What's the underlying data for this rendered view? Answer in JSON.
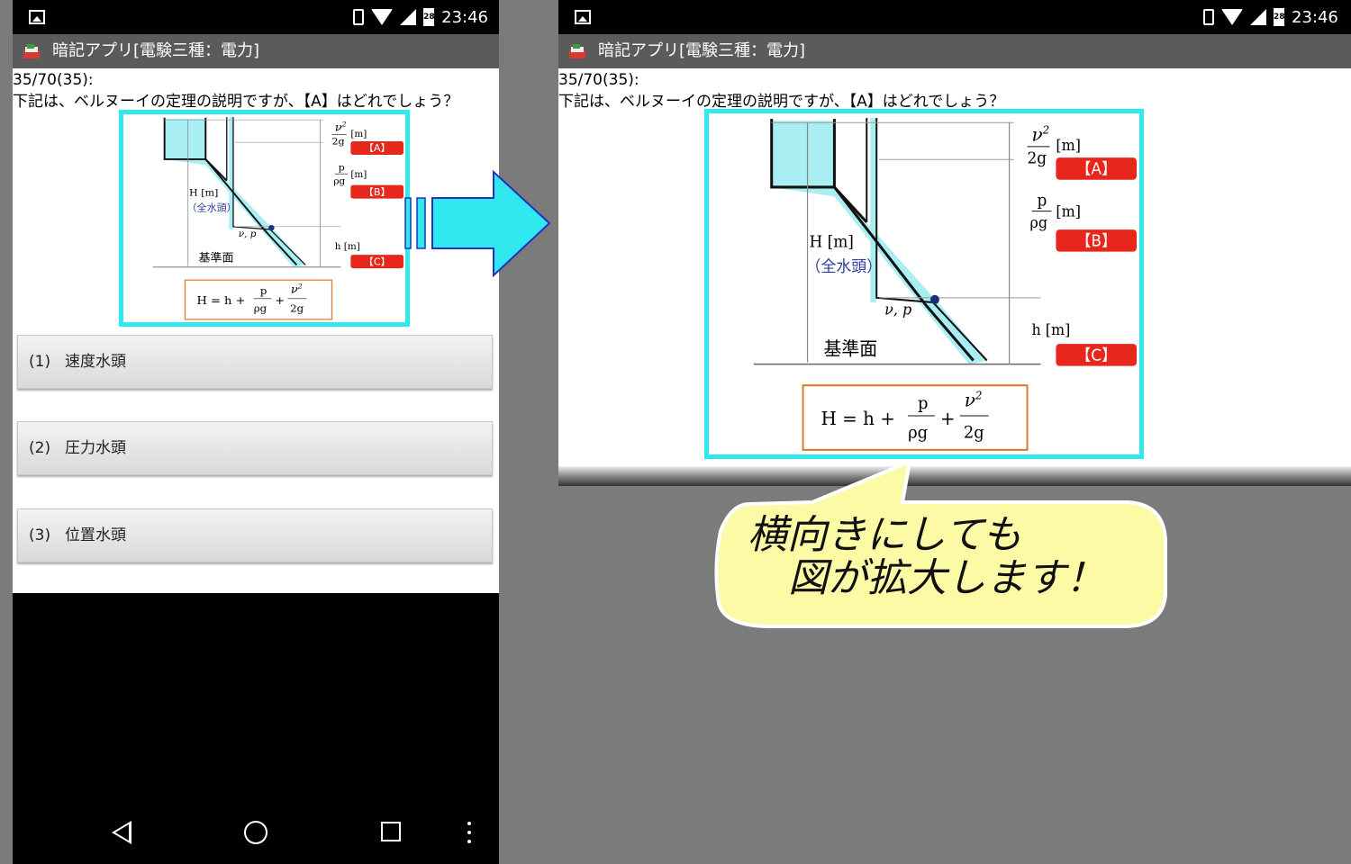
{
  "status": {
    "clock": "23:46",
    "battery": "28"
  },
  "app": {
    "title": "暗記アプリ[電験三種：電力]"
  },
  "question": {
    "number": "35/70(35):",
    "text": "下記は、ベルヌーイの定理の説明ですが、【A】はどれでしょう？"
  },
  "answers": [
    {
      "num": "(1)",
      "label": "速度水頭"
    },
    {
      "num": "(2)",
      "label": "圧力水頭"
    },
    {
      "num": "(3)",
      "label": "位置水頭"
    }
  ],
  "diagram": {
    "label_a": "【A】",
    "label_b": "【B】",
    "label_c": "【C】",
    "h_label": "H [m]",
    "h_sub": "（全水頭）",
    "base_label": "基準面",
    "vp_label": "ν, p",
    "small_h_label": "h [m]",
    "v2_num": "ν",
    "sq": "2",
    "den_2g": "2g",
    "p_num": "p",
    "den_rhog": "ρg",
    "unit_m": "[m]",
    "formula_lhs": "H = h +",
    "plus": "+"
  },
  "callout": {
    "line1": "横向きにしても",
    "line2": "図が拡大します！"
  },
  "colors": {
    "accent": "#30e8f0",
    "water": "#a8eef2",
    "label_red": "#e8271c",
    "bubble": "#fdfaa6"
  }
}
